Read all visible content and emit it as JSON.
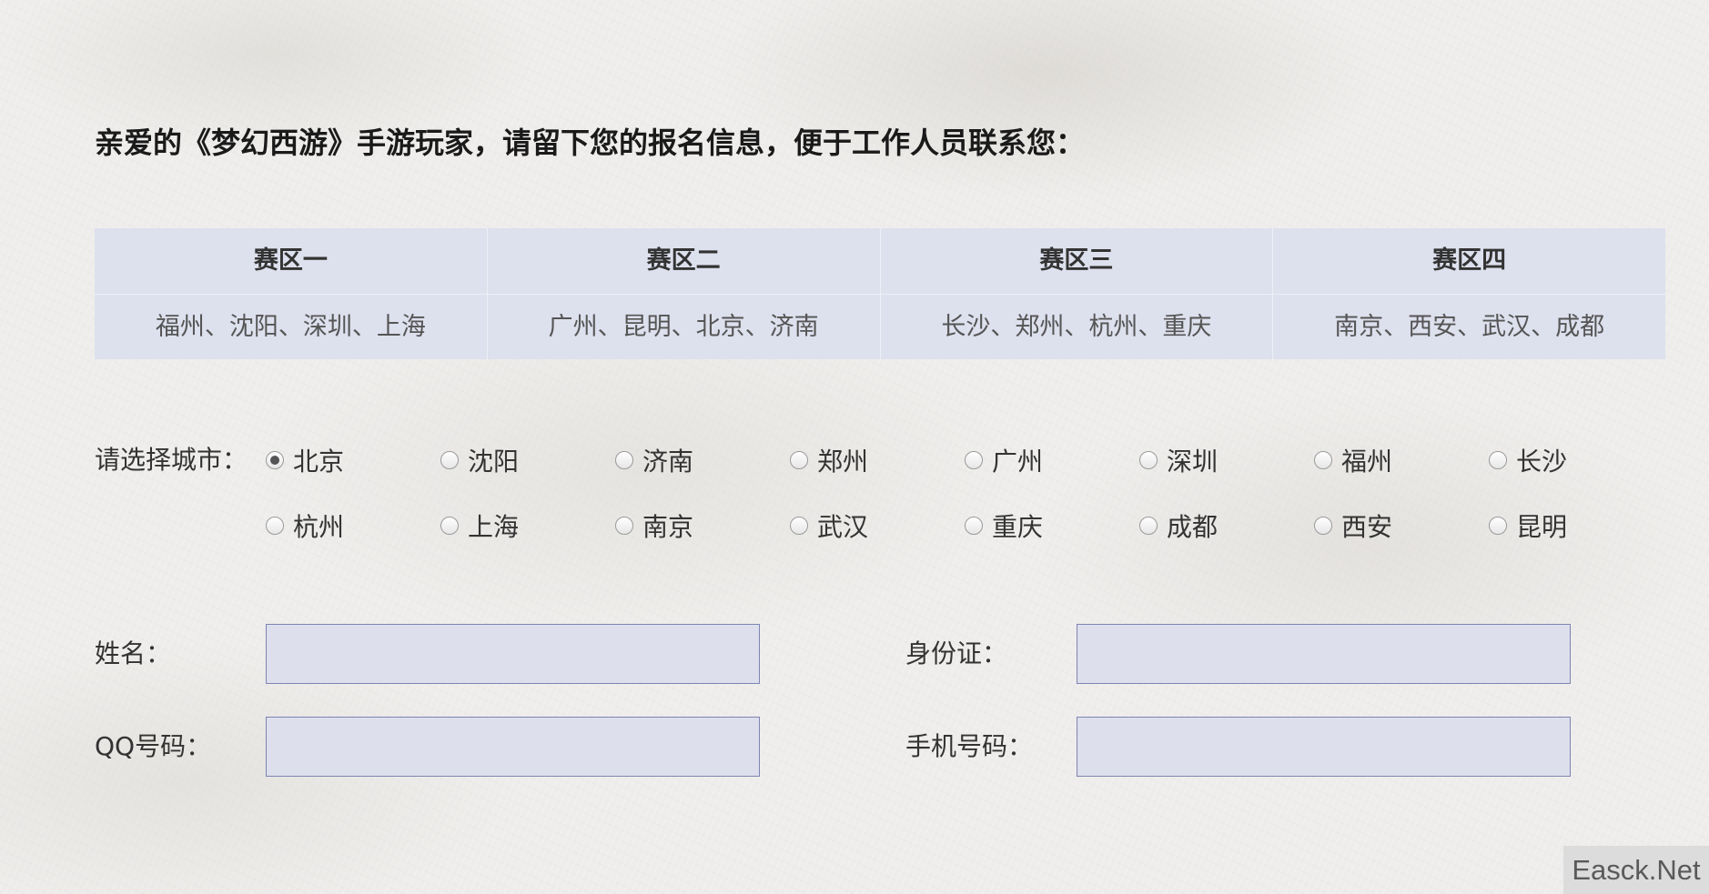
{
  "heading": "亲爱的《梦幻西游》手游玩家，请留下您的报名信息，便于工作人员联系您：",
  "zones": [
    {
      "title": "赛区一",
      "cities": "福州、沈阳、深圳、上海"
    },
    {
      "title": "赛区二",
      "cities": "广州、昆明、北京、济南"
    },
    {
      "title": "赛区三",
      "cities": "长沙、郑州、杭州、重庆"
    },
    {
      "title": "赛区四",
      "cities": "南京、西安、武汉、成都"
    }
  ],
  "city_select": {
    "label": "请选择城市：",
    "selected": "北京",
    "options": [
      "北京",
      "沈阳",
      "济南",
      "郑州",
      "广州",
      "深圳",
      "福州",
      "长沙",
      "杭州",
      "上海",
      "南京",
      "武汉",
      "重庆",
      "成都",
      "西安",
      "昆明"
    ]
  },
  "form": {
    "name_label": "姓名：",
    "name_value": "",
    "id_label": "身份证：",
    "id_value": "",
    "qq_label": "QQ号码：",
    "qq_value": "",
    "phone_label": "手机号码：",
    "phone_value": ""
  },
  "watermark": "Easck.Net",
  "colors": {
    "table_bg": "#dde0ed",
    "input_border": "#7d84b2",
    "input_bg": "#dde0ec"
  }
}
